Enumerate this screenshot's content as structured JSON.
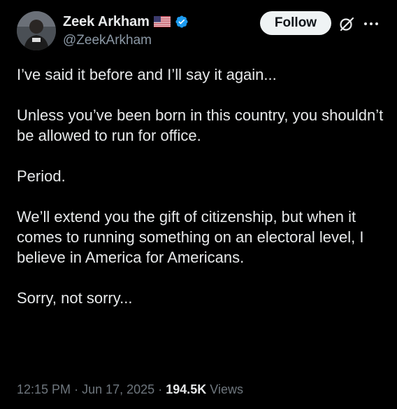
{
  "header": {
    "display_name": "Zeek Arkham",
    "handle": "@ZeekArkham",
    "follow_label": "Follow",
    "flag_icon": "us-flag-icon",
    "verified_icon": "verified-badge-icon",
    "verified_color": "#1d9bf0"
  },
  "tweet": {
    "paragraphs": [
      "I’ve said it before and I’ll say it again...",
      "Unless you’ve been born in this country, you shouldn’t be allowed to run for office.",
      "Period.",
      "We’ll extend you the gift of citizenship, but when it comes to running something on an electoral level, I believe in America for Americans.",
      "Sorry, not sorry..."
    ]
  },
  "meta": {
    "time": "12:15 PM",
    "sep1": "·",
    "date": "Jun 17, 2025",
    "sep2": "·",
    "views_count": "194.5K",
    "views_label": "Views"
  }
}
